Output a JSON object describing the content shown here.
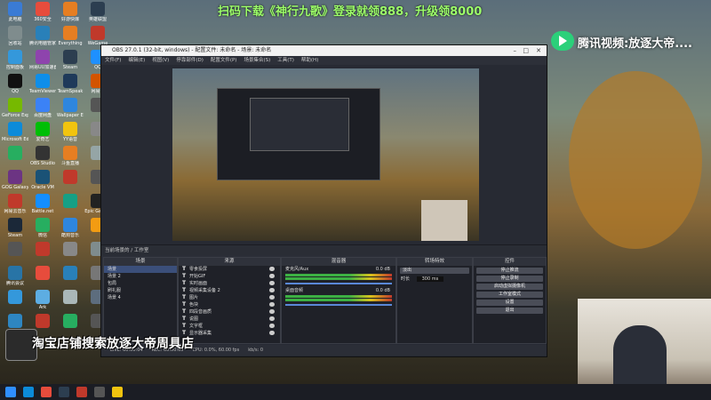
{
  "banner": "扫码下载《神行九歌》登录就领888，升级领8000",
  "tencent_label": "腾讯视频:放逐大帝....",
  "shop_text": "淘宝店铺搜索放逐大帝周具店",
  "desktop_icons": [
    {
      "label": "此电脑",
      "color": "#3a7bd5"
    },
    {
      "label": "360安全",
      "color": "#e74c3c"
    },
    {
      "label": "好游快爆",
      "color": "#e67e22"
    },
    {
      "label": "英雄联盟",
      "color": "#2c3e50"
    },
    {
      "label": "回收站",
      "color": "#7f8c8d"
    },
    {
      "label": "腾讯电脑管家",
      "color": "#2980b9"
    },
    {
      "label": "Everything",
      "color": "#e67e22"
    },
    {
      "label": "WeGame",
      "color": "#c0392b"
    },
    {
      "label": "控制面板",
      "color": "#3498db"
    },
    {
      "label": "网易UU加速器",
      "color": "#8e44ad"
    },
    {
      "label": "Steam",
      "color": "#2c3e50"
    },
    {
      "label": "QQ",
      "color": "#1e90ff"
    },
    {
      "label": "QQ",
      "color": "#111"
    },
    {
      "label": "TeamViewer",
      "color": "#0e8ee9"
    },
    {
      "label": "TeamSpeak",
      "color": "#1f3a5a"
    },
    {
      "label": "网易云",
      "color": "#d35400"
    },
    {
      "label": "GeForce Experience",
      "color": "#76b900"
    },
    {
      "label": "百度网盘",
      "color": "#3b82f6"
    },
    {
      "label": "Wallpaper Engine",
      "color": "#2e86de"
    },
    {
      "label": "",
      "color": "#555"
    },
    {
      "label": "Microsoft Edge",
      "color": "#0c8bd9"
    },
    {
      "label": "爱奇艺",
      "color": "#00be06"
    },
    {
      "label": "YY语音",
      "color": "#f1c40f"
    },
    {
      "label": "",
      "color": "#888"
    },
    {
      "label": "",
      "color": "#27ae60"
    },
    {
      "label": "OBS Studio",
      "color": "#333"
    },
    {
      "label": "斗鱼直播",
      "color": "#e67e22"
    },
    {
      "label": "",
      "color": "#95a5a6"
    },
    {
      "label": "GOG Galaxy",
      "color": "#6c3483"
    },
    {
      "label": "Oracle VM",
      "color": "#1a5276"
    },
    {
      "label": "",
      "color": "#c0392b"
    },
    {
      "label": "",
      "color": "#555"
    },
    {
      "label": "网易云音乐",
      "color": "#c0392b"
    },
    {
      "label": "Battle.net",
      "color": "#148eff"
    },
    {
      "label": "",
      "color": "#16a085"
    },
    {
      "label": "Epic Games",
      "color": "#222"
    },
    {
      "label": "Steam",
      "color": "#1b2838"
    },
    {
      "label": "微信",
      "color": "#27ae60"
    },
    {
      "label": "酷狗音乐",
      "color": "#2e86de"
    },
    {
      "label": "",
      "color": "#f39c12"
    },
    {
      "label": "",
      "color": "#555"
    },
    {
      "label": "",
      "color": "#c0392b"
    },
    {
      "label": "",
      "color": "#888"
    },
    {
      "label": "",
      "color": "#7f8c8d"
    },
    {
      "label": "腾讯会议",
      "color": "#2874a6"
    },
    {
      "label": "",
      "color": "#e74c3c"
    },
    {
      "label": "",
      "color": "#2980b9"
    },
    {
      "label": "",
      "color": "#777"
    },
    {
      "label": "",
      "color": "#3498db"
    },
    {
      "label": "Ark",
      "color": "#5dade2"
    },
    {
      "label": "",
      "color": "#aab7b8"
    },
    {
      "label": "",
      "color": "#5d6d7e"
    },
    {
      "label": "",
      "color": "#2e86c1"
    },
    {
      "label": "",
      "color": "#c0392b"
    },
    {
      "label": "",
      "color": "#27ae60"
    },
    {
      "label": "",
      "color": "#555"
    }
  ],
  "obs": {
    "title": "OBS 27.0.1 (32-bit, windows) - 配置文件: 未命名 - 场景: 未命名",
    "menu": [
      "文件(F)",
      "编辑(E)",
      "视图(V)",
      "停靠部件(D)",
      "配置文件(P)",
      "场景集合(S)",
      "工具(T)",
      "帮助(H)"
    ],
    "preview_tip": "当前场景的 / 工作室",
    "docks": {
      "scenes": {
        "title": "场景",
        "items": [
          "场景",
          "场景 2",
          "包局",
          "刷礼服",
          "场景 4"
        ]
      },
      "sources": {
        "title": "来源",
        "items": [
          "零食投屏",
          "开始GIF",
          "实时画面",
          "视频采集设备 2",
          "图片",
          "色块",
          "四段音画质",
          "说图",
          "文字框",
          "显示器采集"
        ]
      },
      "mixer": {
        "title": "混音器",
        "tracks": [
          {
            "name": "麦克风/Aux",
            "level": "0.0 dB"
          },
          {
            "name": "桌面音频",
            "level": "0.0 dB"
          }
        ]
      },
      "transitions": {
        "title": "转场特效",
        "type": "淡出",
        "duration_label": "时长",
        "duration": "300 ms"
      },
      "controls": {
        "title": "控件",
        "buttons": [
          "停止推流",
          "停止录制",
          "启动虚拟摄像机",
          "工作室模式",
          "设置",
          "退出"
        ]
      }
    },
    "status": [
      "LIVE: 00:00:04",
      "REC: 00:00:05",
      "CPU: 0.0%, 60.00 fps",
      "kb/s: 0"
    ]
  }
}
